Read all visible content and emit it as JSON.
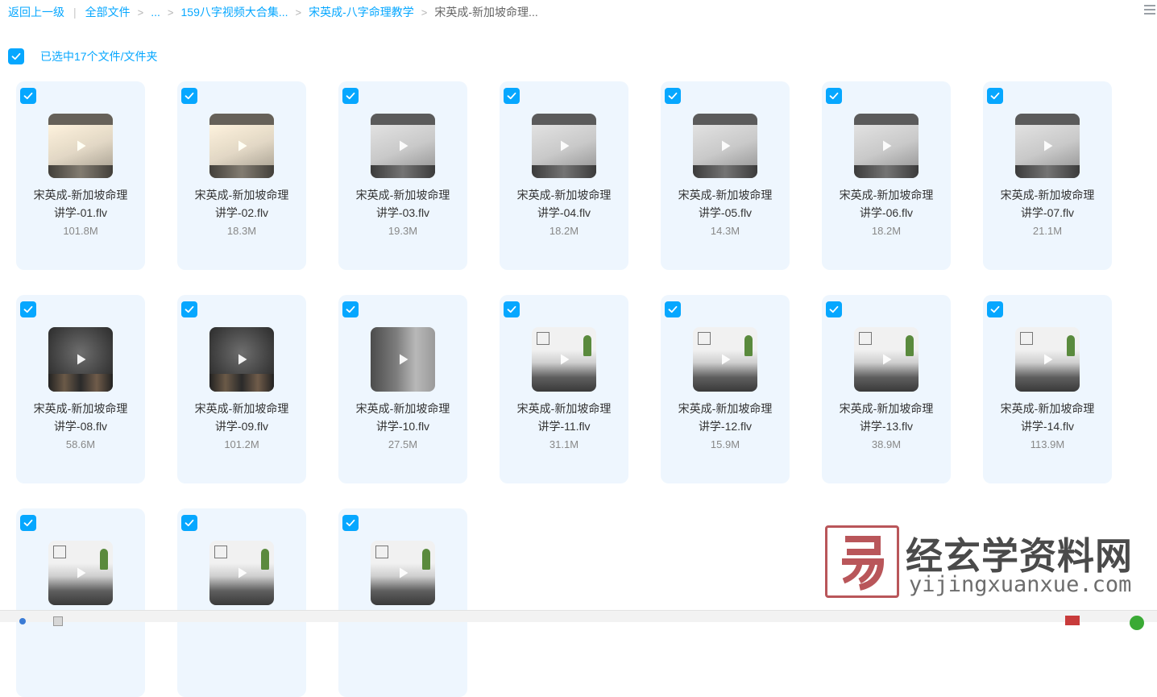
{
  "breadcrumb": {
    "back": "返回上一级",
    "items": [
      "全部文件",
      "...",
      "159八字视频大合集...",
      "宋英成-八字命理教学",
      "宋英成-新加坡命理..."
    ]
  },
  "selection": {
    "label": "已选中17个文件/文件夹",
    "all_checked": true
  },
  "files": [
    {
      "name_line1": "宋英成-新加坡命理",
      "name_line2": "讲学-01.flv",
      "size": "101.8M",
      "thumb": "warm"
    },
    {
      "name_line1": "宋英成-新加坡命理",
      "name_line2": "讲学-02.flv",
      "size": "18.3M",
      "thumb": "warm"
    },
    {
      "name_line1": "宋英成-新加坡命理",
      "name_line2": "讲学-03.flv",
      "size": "19.3M",
      "thumb": "whiteboard"
    },
    {
      "name_line1": "宋英成-新加坡命理",
      "name_line2": "讲学-04.flv",
      "size": "18.2M",
      "thumb": "whiteboard"
    },
    {
      "name_line1": "宋英成-新加坡命理",
      "name_line2": "讲学-05.flv",
      "size": "14.3M",
      "thumb": "whiteboard"
    },
    {
      "name_line1": "宋英成-新加坡命理",
      "name_line2": "讲学-06.flv",
      "size": "18.2M",
      "thumb": "whiteboard"
    },
    {
      "name_line1": "宋英成-新加坡命理",
      "name_line2": "讲学-07.flv",
      "size": "21.1M",
      "thumb": "whiteboard"
    },
    {
      "name_line1": "宋英成-新加坡命理",
      "name_line2": "讲学-08.flv",
      "size": "58.6M",
      "thumb": "dark"
    },
    {
      "name_line1": "宋英成-新加坡命理",
      "name_line2": "讲学-09.flv",
      "size": "101.2M",
      "thumb": "dark"
    },
    {
      "name_line1": "宋英成-新加坡命理",
      "name_line2": "讲学-10.flv",
      "size": "27.5M",
      "thumb": "portrait"
    },
    {
      "name_line1": "宋英成-新加坡命理",
      "name_line2": "讲学-11.flv",
      "size": "31.1M",
      "thumb": "classroom"
    },
    {
      "name_line1": "宋英成-新加坡命理",
      "name_line2": "讲学-12.flv",
      "size": "15.9M",
      "thumb": "classroom"
    },
    {
      "name_line1": "宋英成-新加坡命理",
      "name_line2": "讲学-13.flv",
      "size": "38.9M",
      "thumb": "classroom"
    },
    {
      "name_line1": "宋英成-新加坡命理",
      "name_line2": "讲学-14.flv",
      "size": "113.9M",
      "thumb": "classroom"
    },
    {
      "name_line1": "",
      "name_line2": "",
      "size": "",
      "thumb": "classroom"
    },
    {
      "name_line1": "",
      "name_line2": "",
      "size": "",
      "thumb": "classroom"
    },
    {
      "name_line1": "",
      "name_line2": "",
      "size": "",
      "thumb": "classroom"
    }
  ],
  "watermark": {
    "title": "经玄学资料网",
    "url": "yijingxuanxue.com"
  },
  "icons": {
    "check": "check-icon",
    "play": "play-icon",
    "view": "list-view-icon"
  },
  "colors": {
    "accent": "#06a7ff",
    "card_bg": "#eef6fe",
    "watermark_red": "#b9565a"
  }
}
